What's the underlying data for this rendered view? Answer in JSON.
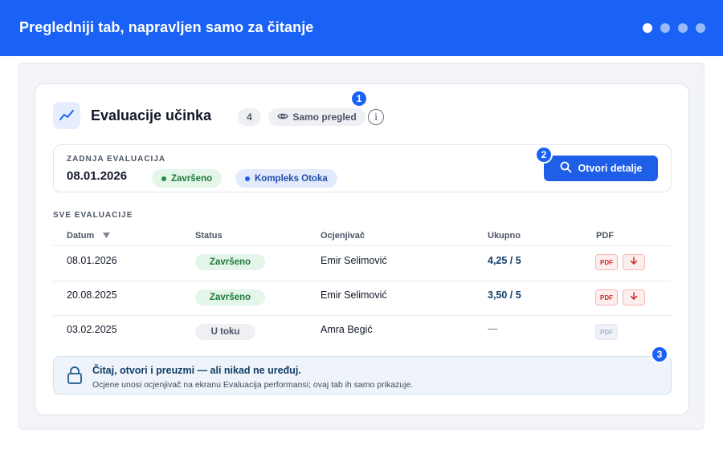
{
  "topbar": {
    "title": "Pregledniji tab, napravljen samo za čitanje",
    "pager_dots": 4,
    "active_dot": 1
  },
  "card": {
    "title": "Evaluacije učinka",
    "icon": "trend-chart-icon",
    "count": "4",
    "readonly_label": "Samo pregled",
    "info_icon": "info-icon",
    "info_glyph": "i"
  },
  "markers": [
    "1",
    "2",
    "3"
  ],
  "last_evaluation": {
    "label": "ZADNJA EVALUACIJA",
    "date": "08.01.2026",
    "status": "Završeno",
    "location": "Kompleks Otoka",
    "open_button": "Otvori detalje"
  },
  "table": {
    "section_label": "SVE EVALUACIJE",
    "sort_icon": "sort-desc-icon",
    "headers": {
      "date": "Datum",
      "status": "Status",
      "evaluator": "Ocjenjivač",
      "total": "Ukupno",
      "pdf": "PDF"
    },
    "pdf_label": "PDF",
    "rows": [
      {
        "date": "08.01.2026",
        "status": "Završeno",
        "evaluator": "Emir Selimović",
        "total": "4,25 / 5",
        "pdf_available": true
      },
      {
        "date": "20.08.2025",
        "status": "Završeno",
        "evaluator": "Emir Selimović",
        "total": "3,50 / 5",
        "pdf_available": true
      },
      {
        "date": "03.02.2025",
        "status": "U toku",
        "evaluator": "Amra Begić",
        "total": "—",
        "pdf_available": false
      }
    ]
  },
  "note": {
    "title": "Čitaj, otvori i preuzmi — ali nikad ne uređuj.",
    "text": "Ocjene unosi ocjenjivač na ekranu Evaluacija performansi; ovaj tab ih samo prikazuje."
  },
  "colors": {
    "brand": "#1a62f5",
    "success": "#1f7a3d",
    "danger": "#d02828"
  }
}
